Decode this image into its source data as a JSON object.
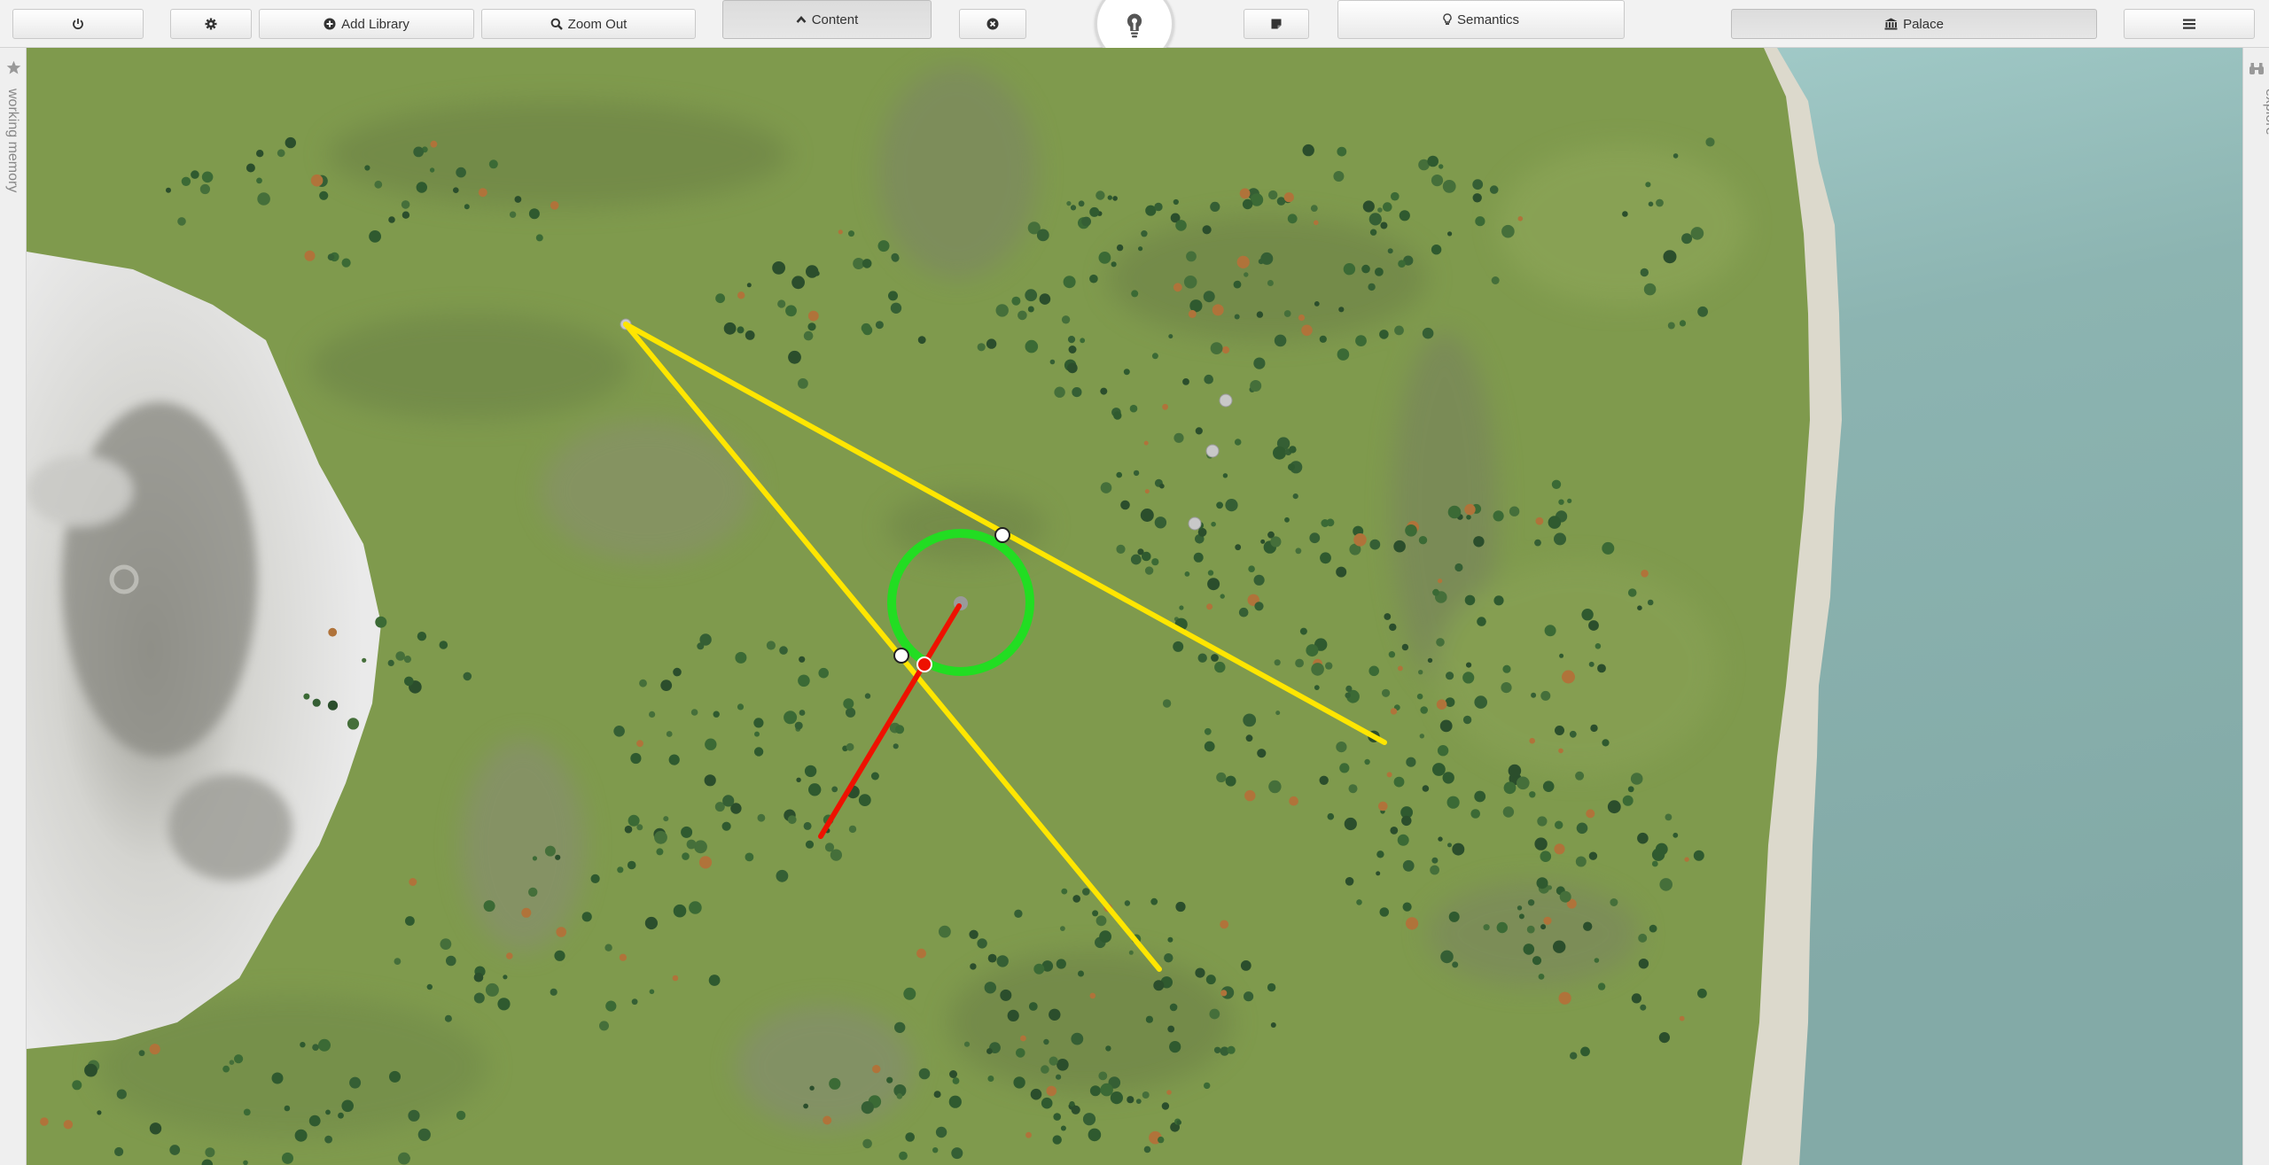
{
  "toolbar": {
    "power_icon": "power-icon",
    "settings_icon": "gear-icon",
    "add_library_label": "Add Library",
    "add_library_icon": "plus-circle-icon",
    "zoom_out_label": "Zoom Out",
    "zoom_out_icon": "search-icon",
    "content_label": "Content",
    "content_icon": "chevron-up-icon",
    "close_icon": "close-circle-icon",
    "bulb_icon": "lightbulb-icon",
    "notes_icon": "note-icon",
    "semantics_label": "Semantics",
    "semantics_icon": "lightbulb-icon",
    "palace_label": "Palace",
    "palace_icon": "institution-icon",
    "menu_icon": "menu-icon"
  },
  "left_panel": {
    "label": "working memory",
    "icon": "star-icon"
  },
  "right_panel": {
    "label": "explore",
    "icon": "binoculars-icon"
  },
  "map": {
    "terrain_color": "#7f9a4d",
    "rock_color": "#8c8c84",
    "snow_color": "#e4e4e4",
    "water_color": "#88b0ad",
    "beach_color": "#d8d5c8",
    "view_lines_color": "#ffe600",
    "focus_ring_color": "#22dd22",
    "direction_line_color": "#ee1100"
  }
}
